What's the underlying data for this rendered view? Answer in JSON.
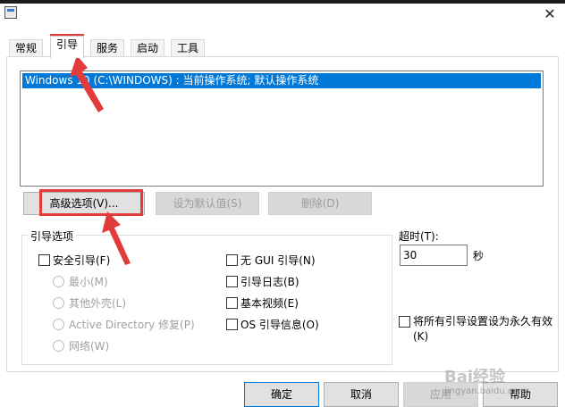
{
  "window": {
    "close_glyph": "✕"
  },
  "tabs": [
    {
      "label": "常规"
    },
    {
      "label": "引导"
    },
    {
      "label": "服务"
    },
    {
      "label": "启动"
    },
    {
      "label": "工具"
    }
  ],
  "boot_list": {
    "selected_entry": "Windows 10 (C:\\WINDOWS) : 当前操作系统; 默认操作系统"
  },
  "buttons": {
    "advanced": "高级选项(V)...",
    "set_default": "设为默认值(S)",
    "delete": "删除(D)"
  },
  "boot_options": {
    "title": "引导选项",
    "safe_boot": "安全引导(F)",
    "minimal": "最小(M)",
    "alternate_shell": "其他外壳(L)",
    "active_directory": "Active Directory 修复(P)",
    "network": "网络(W)",
    "no_gui": "无 GUI 引导(N)",
    "boot_log": "引导日志(B)",
    "base_video": "基本视频(E)",
    "os_info": "OS 引导信息(O)"
  },
  "timeout": {
    "label": "超时(T):",
    "value": "30",
    "unit": "秒"
  },
  "permanent": {
    "line1": "将所有引导设置设为永久有效",
    "line2": "(K)"
  },
  "footer": {
    "ok": "确定",
    "cancel": "取消",
    "apply": "应用",
    "help": "帮助"
  },
  "watermark": {
    "brand": "Bai经验",
    "url": "jingyan.baidu.com"
  },
  "colors": {
    "highlight": "#0078d7",
    "annotation": "#e23b3b"
  }
}
